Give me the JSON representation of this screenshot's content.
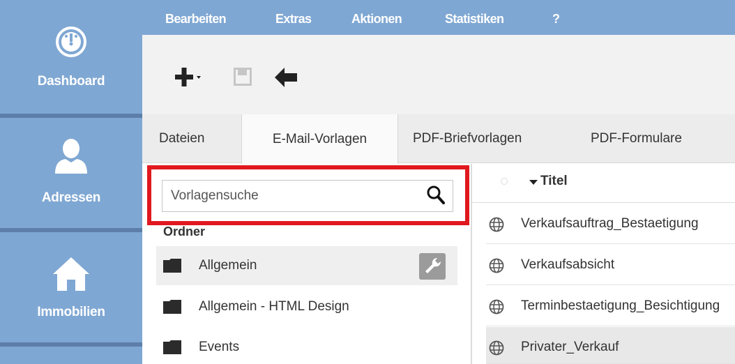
{
  "sidebar": {
    "items": [
      {
        "label": "Dashboard",
        "icon": "dashboard-gauge-icon"
      },
      {
        "label": "Adressen",
        "icon": "person-icon"
      },
      {
        "label": "Immobilien",
        "icon": "house-icon"
      }
    ]
  },
  "menu": {
    "items": [
      "Bearbeiten",
      "Extras",
      "Aktionen",
      "Statistiken",
      "?"
    ]
  },
  "toolbar": {
    "icons": [
      "add-dropdown-icon",
      "save-icon",
      "back-arrow-icon"
    ]
  },
  "tabs": [
    "Dateien",
    "E-Mail-Vorlagen",
    "PDF-Briefvorlagen",
    "PDF-Formulare"
  ],
  "search": {
    "placeholder": "Vorlagensuche",
    "value": ""
  },
  "folders": {
    "heading": "Ordner",
    "items": [
      "Allgemein",
      "Allgemein - HTML Design",
      "Events"
    ]
  },
  "list": {
    "column_title": "Titel",
    "rows": [
      "Verkaufsauftrag_Bestaetigung",
      "Verkaufsabsicht",
      "Terminbestaetigung_Besichtigung",
      "Privater_Verkauf"
    ]
  },
  "colors": {
    "sidebar": "#7fa7d3",
    "highlight": "#e0191f"
  }
}
